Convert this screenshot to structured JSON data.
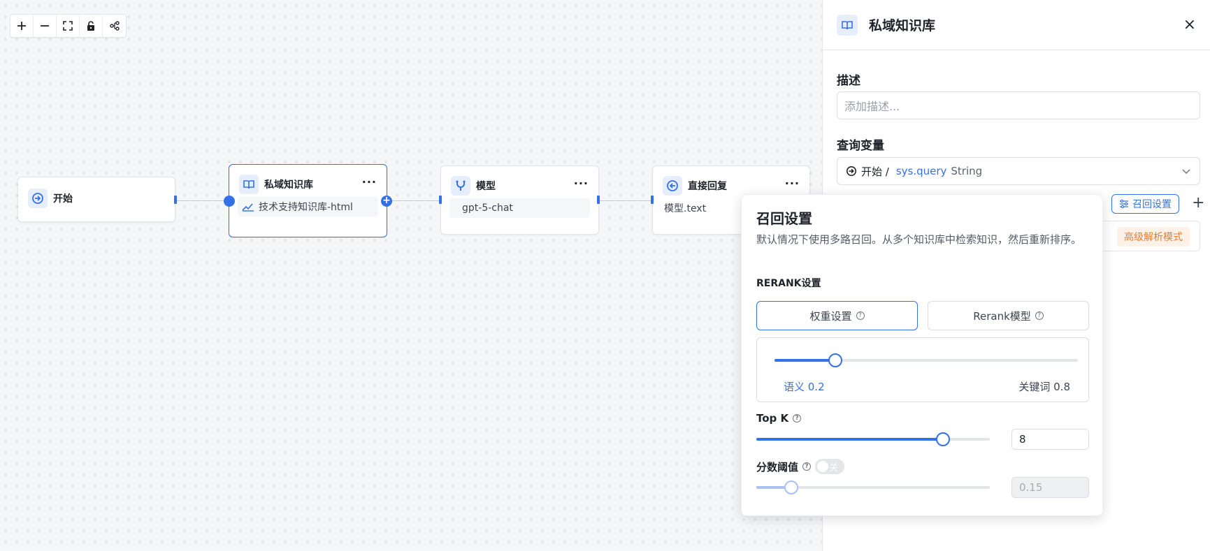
{
  "toolbar": {
    "icons": [
      "plus-icon",
      "minus-icon",
      "fullscreen-icon",
      "lock-icon",
      "layout-icon"
    ]
  },
  "nodes": {
    "start": {
      "title": "开始",
      "icon": "start-icon"
    },
    "kb": {
      "title": "私域知识库",
      "more": "···",
      "body": "技术支持知识库-html",
      "icon": "book-icon"
    },
    "model": {
      "title": "模型",
      "more": "···",
      "body": "gpt-5-chat",
      "icon": "model-icon"
    },
    "reply": {
      "title": "直接回复",
      "more": "···",
      "body": "模型.text",
      "icon": "reply-icon"
    }
  },
  "panel": {
    "title": "私域知识库",
    "close": "×",
    "desc_label": "描述",
    "desc_placeholder": "添加描述...",
    "query_label": "查询变量",
    "query_source": "开始 /",
    "query_var": "sys.query",
    "query_type": "String",
    "recall_btn": "召回设置",
    "add": "+",
    "kb_badge": "高级解析模式"
  },
  "popover": {
    "title": "召回设置",
    "description": "默认情况下使用多路召回。从多个知识库中检索知识，然后重新排序。",
    "rerank_label": "RERANK设置",
    "tab_weight": "权重设置",
    "tab_rerank": "Rerank模型",
    "help": "?",
    "semantic_label": "语义 0.2",
    "keyword_label": "关键词 0.8",
    "semantic_weight": 0.2,
    "topk_label": "Top K",
    "topk_value": "8",
    "topk_level": 0.8,
    "score_label": "分数阈值",
    "score_toggle": "关",
    "score_value": "0.15",
    "score_level": 0.15
  },
  "colors": {
    "accent": "#3470e8",
    "badge_text": "#ea7c2e",
    "badge_bg": "#fdf1e8"
  }
}
